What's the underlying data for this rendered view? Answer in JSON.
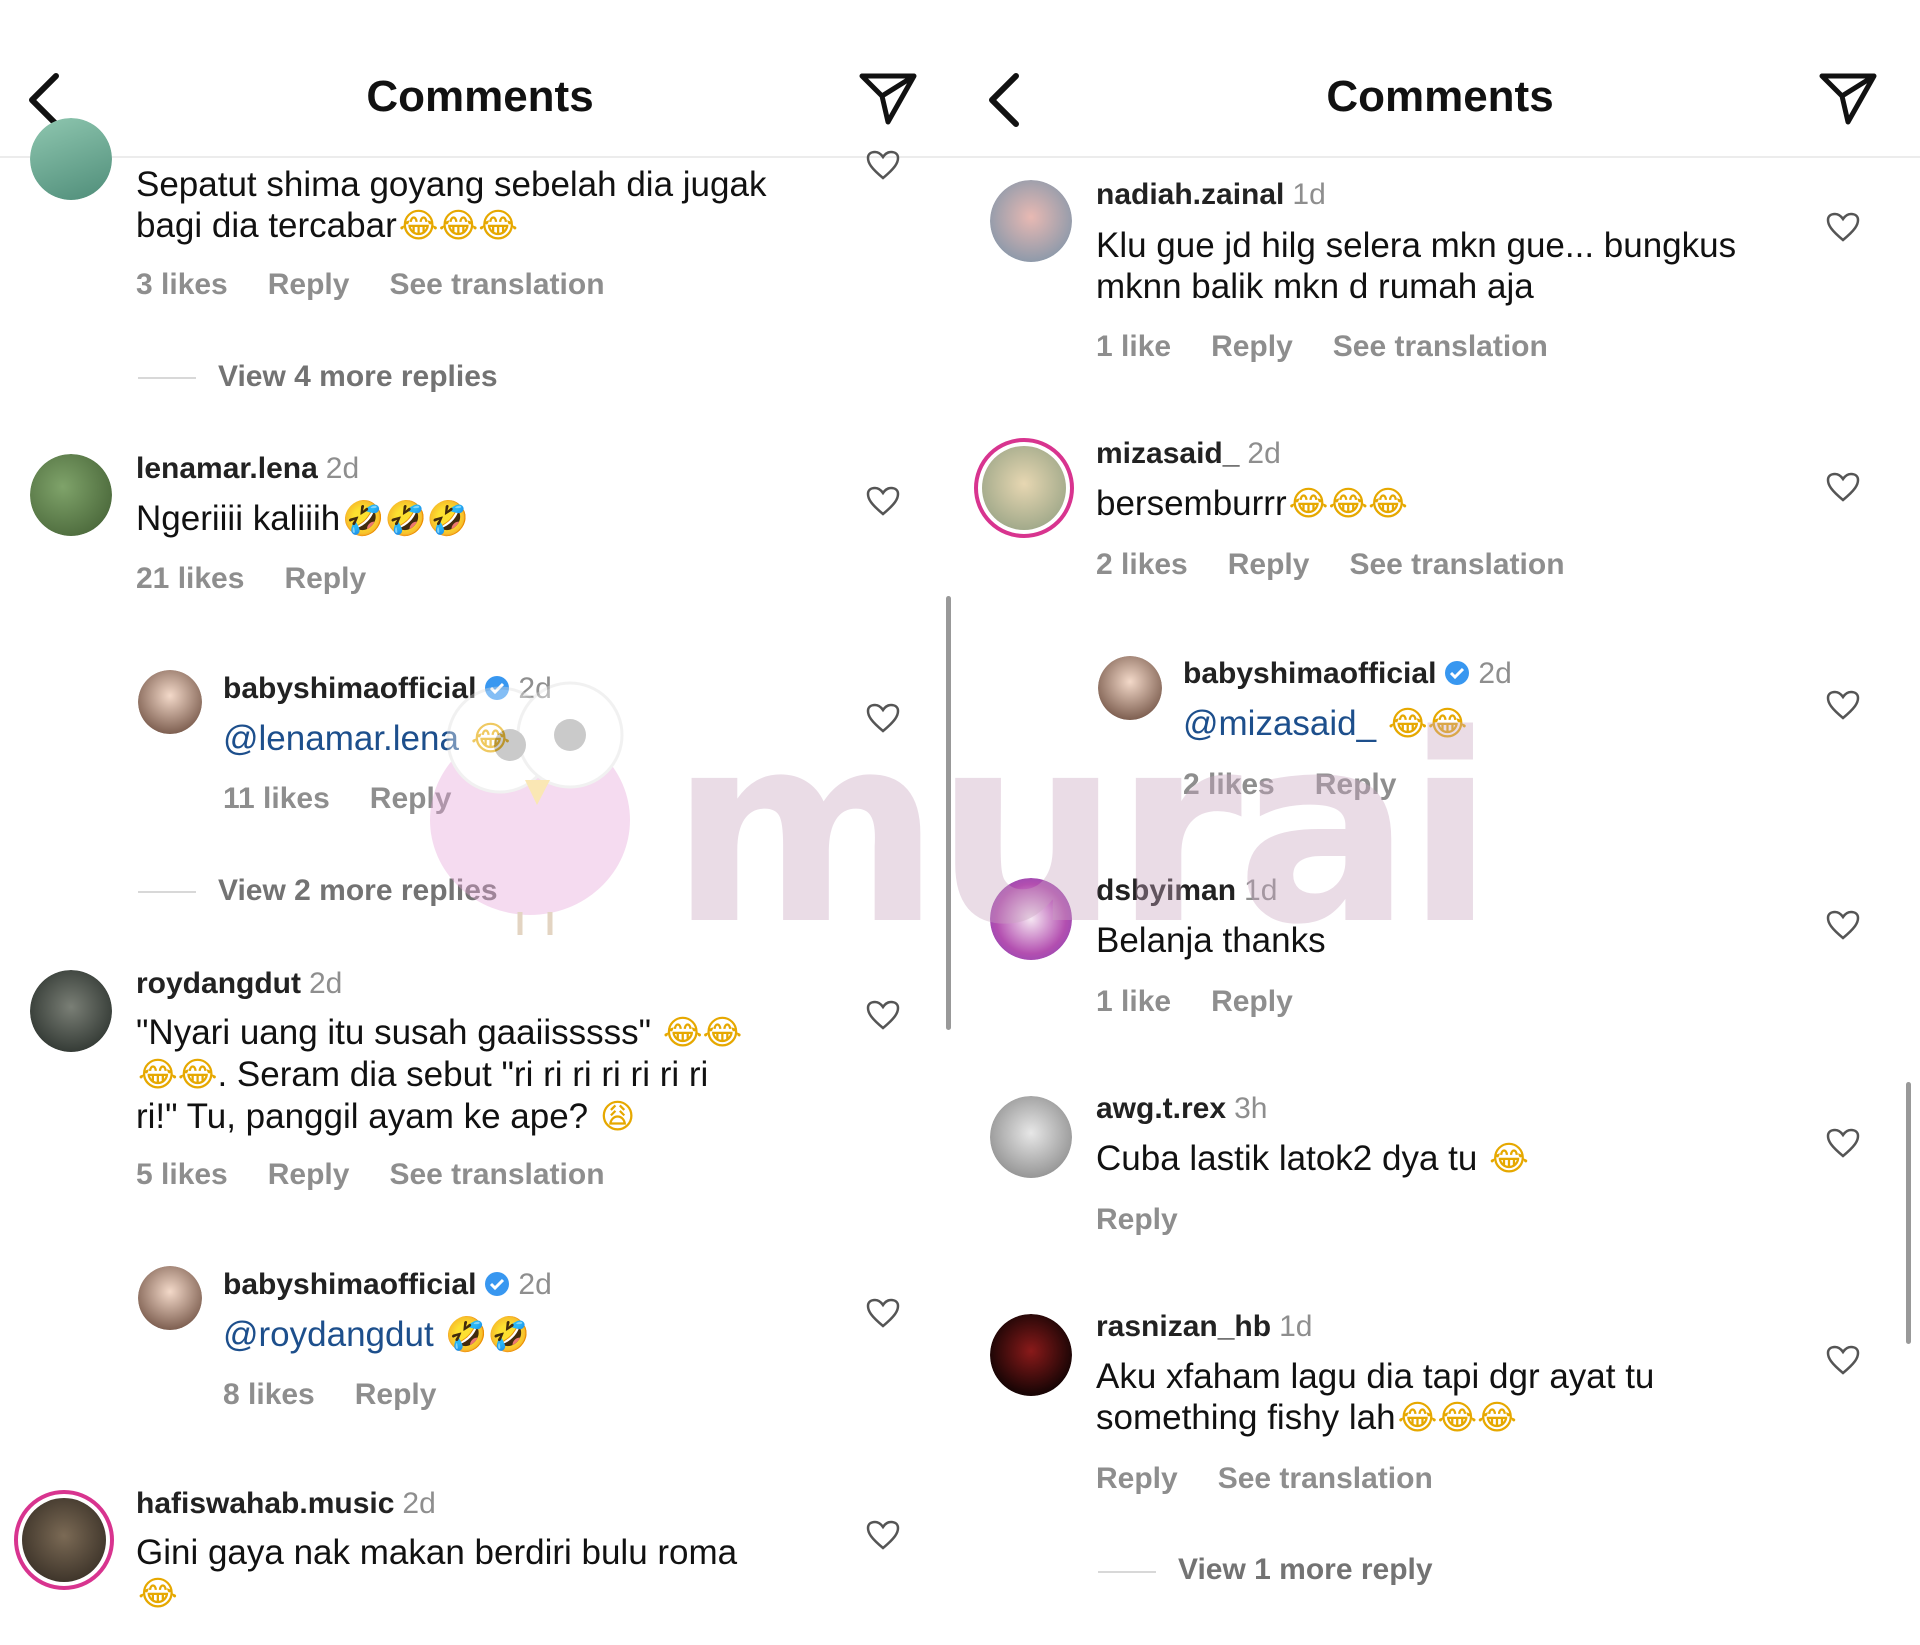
{
  "left": {
    "header": {
      "title": "Comments",
      "back_icon": "back-chevron-icon",
      "send_icon": "send-paper-plane-icon"
    },
    "comments": [
      {
        "username": "",
        "time": "",
        "text": "Sepatut shima goyang sebelah dia jugak bagi dia tercabar",
        "emoji": "😂😂😂",
        "likes": "3 likes",
        "reply": "Reply",
        "translate": "See translation",
        "view_more": "View 4 more replies"
      },
      {
        "username": "lenamar.lena",
        "time": "2d",
        "text": "Ngeriiii kaliiih",
        "emoji": "🤣🤣🤣",
        "likes": "21 likes",
        "reply": "Reply"
      },
      {
        "username": "babyshimaofficial",
        "time": "2d",
        "mention": "@lenamar.lena",
        "emoji": "😂",
        "likes": "11 likes",
        "reply": "Reply",
        "view_more": "View 2 more replies"
      },
      {
        "username": "roydangdut",
        "time": "2d",
        "text1": "\"Nyari uang itu susah gaaiisssss\"",
        "emoji1": "😂😂",
        "emoji2": "😂😂",
        "text2": ". Seram dia sebut \"ri ri ri ri ri ri ri",
        "text3": "ri!\" Tu, panggil ayam ke ape?",
        "emoji3": "😩",
        "likes": "5 likes",
        "reply": "Reply",
        "translate": "See translation"
      },
      {
        "username": "babyshimaofficial",
        "time": "2d",
        "mention": "@roydangdut",
        "emoji": "🤣🤣",
        "likes": "8 likes",
        "reply": "Reply"
      },
      {
        "username": "hafiswahab.music",
        "time": "2d",
        "text": "Gini gaya nak makan berdiri bulu roma",
        "emoji": "😂"
      }
    ]
  },
  "right": {
    "header": {
      "title": "Comments",
      "back_icon": "back-chevron-icon",
      "send_icon": "send-paper-plane-icon"
    },
    "comments": [
      {
        "username": "nadiah.zainal",
        "time": "1d",
        "text1": "Klu gue jd hilg selera mkn gue... bungkus",
        "text2": "mknn balik mkn d rumah aja",
        "likes": "1 like",
        "reply": "Reply",
        "translate": "See translation"
      },
      {
        "username": "mizasaid_",
        "time": "2d",
        "text": "bersemburrr",
        "emoji": "😂😂😂",
        "likes": "2 likes",
        "reply": "Reply",
        "translate": "See translation"
      },
      {
        "username": "babyshimaofficial",
        "time": "2d",
        "mention": "@mizasaid_",
        "emoji": "😂😂",
        "likes": "2 likes",
        "reply": "Reply"
      },
      {
        "username": "dsbyiman",
        "time": "1d",
        "text": "Belanja thanks",
        "likes": "1 like",
        "reply": "Reply"
      },
      {
        "username": "awg.t.rex",
        "time": "3h",
        "text": "Cuba lastik latok2 dya tu",
        "emoji": "😂",
        "reply": "Reply"
      },
      {
        "username": "rasnizan_hb",
        "time": "1d",
        "text1": "Aku xfaham lagu dia tapi dgr ayat tu",
        "text2": "something fishy lah",
        "emoji": "😂😂😂",
        "reply": "Reply",
        "translate": "See translation",
        "view_more": "View 1 more reply"
      }
    ]
  },
  "watermark": {
    "text": "murai"
  },
  "colors": {
    "mention": "#1d4f8c",
    "muted": "#8e8e8e",
    "verified": "#3897f0",
    "story_ring": "#d8348f"
  }
}
